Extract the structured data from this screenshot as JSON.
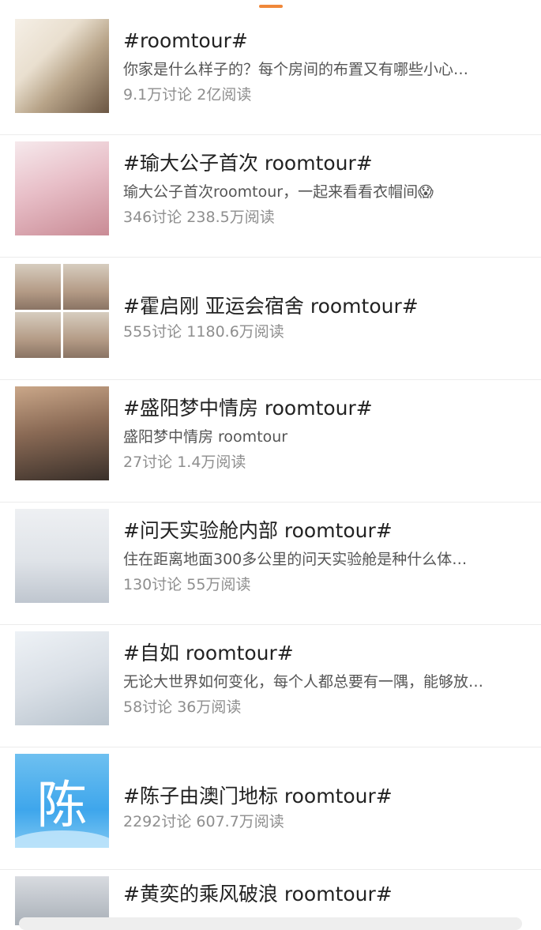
{
  "items": [
    {
      "title": "#roomtour#",
      "desc": "你家是什么样子的？每个房间的布置又有哪些小心…",
      "stats": "9.1万讨论 2亿阅读",
      "thumb": "room-interior"
    },
    {
      "title": "#瑜大公子首次 roomtour#",
      "desc": "瑜大公子首次roomtour，一起来看看衣帽间😱",
      "stats": "346讨论 238.5万阅读",
      "thumb": "man-in-pink-sweater"
    },
    {
      "title": "#霍启刚 亚运会宿舍 roomtour#",
      "desc": "",
      "stats": "555讨论 1180.6万阅读",
      "thumb": "four-photo-grid"
    },
    {
      "title": "#盛阳梦中情房 roomtour#",
      "desc": "盛阳梦中情房 roomtour",
      "stats": "27讨论 1.4万阅读",
      "thumb": "portrait"
    },
    {
      "title": "#问天实验舱内部 roomtour#",
      "desc": "住在距离地面300多公里的问天实验舱是种什么体…",
      "stats": "130讨论 55万阅读",
      "thumb": "space-module"
    },
    {
      "title": "#自如 roomtour#",
      "desc": "无论大世界如何变化，每个人都总要有一隅，能够放…",
      "stats": "58讨论 36万阅读",
      "thumb": "bedroom-desk"
    },
    {
      "title": "#陈子由澳门地标 roomtour#",
      "desc": "",
      "stats": "2292讨论 607.7万阅读",
      "thumb": "chen-avatar",
      "thumb_text": "陈"
    },
    {
      "title": "#黄奕的乘风破浪 roomtour#",
      "desc": "",
      "stats": "",
      "thumb": "woman-photo"
    }
  ],
  "colors": {
    "accent_handle": "#f0883a",
    "avatar_blue": "#3ea6ec"
  }
}
